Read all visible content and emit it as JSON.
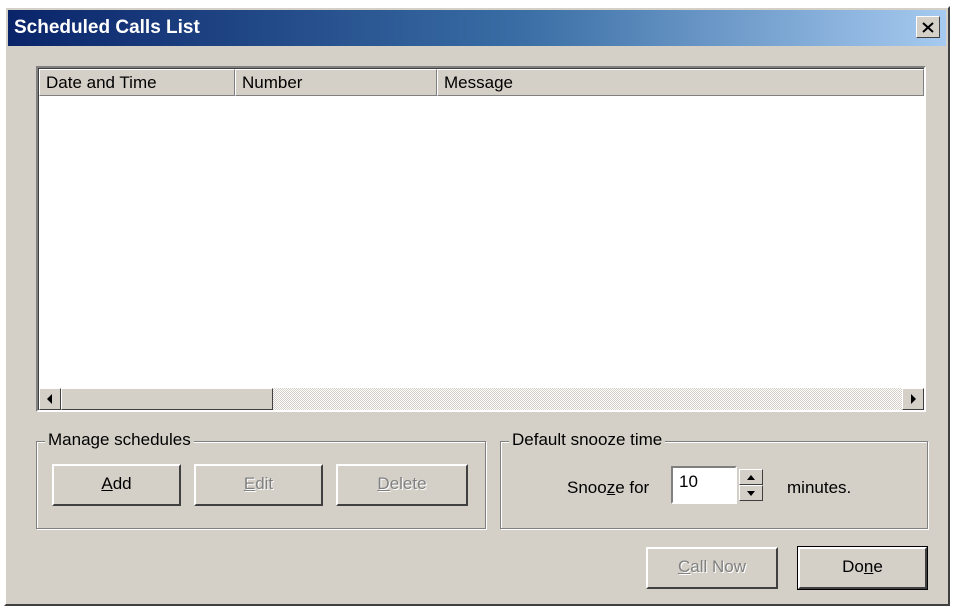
{
  "window": {
    "title": "Scheduled Calls List",
    "close_icon": "close-icon"
  },
  "list": {
    "columns": [
      "Date and Time",
      "Number",
      "Message"
    ],
    "rows": []
  },
  "manage": {
    "legend": "Manage schedules",
    "add_prefix": "",
    "add_mnemonic": "A",
    "add_suffix": "dd",
    "edit_prefix": "",
    "edit_mnemonic": "E",
    "edit_suffix": "dit",
    "delete_prefix": "",
    "delete_mnemonic": "D",
    "delete_suffix": "elete"
  },
  "snooze": {
    "legend": "Default snooze time",
    "label_prefix": "Snoo",
    "label_mnemonic": "z",
    "label_suffix": "e for",
    "value": "10",
    "unit": "minutes."
  },
  "footer": {
    "callnow_prefix": "",
    "callnow_mnemonic": "C",
    "callnow_suffix": "all Now",
    "done_prefix": "Do",
    "done_mnemonic": "n",
    "done_suffix": "e"
  }
}
